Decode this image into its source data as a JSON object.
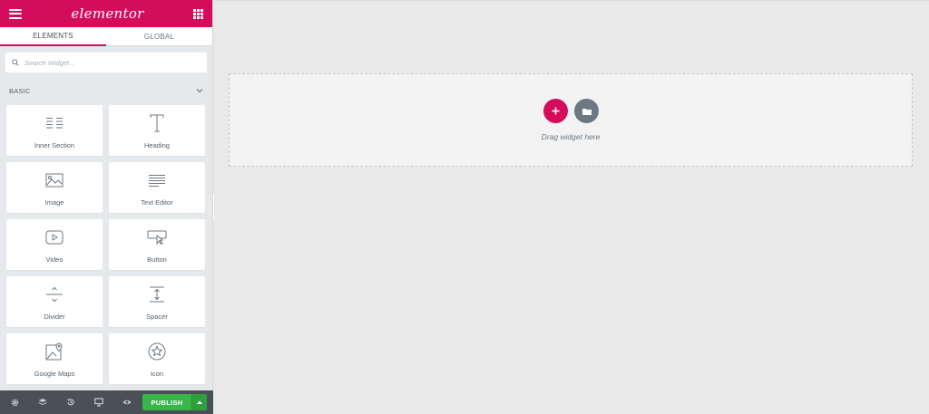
{
  "header": {
    "logo_text": "elementor",
    "menu_icon": "hamburger-icon",
    "apps_icon": "grid-icon"
  },
  "tabs": [
    {
      "label": "ELEMENTS",
      "active": true
    },
    {
      "label": "GLOBAL",
      "active": false
    }
  ],
  "search": {
    "placeholder": "Search Widget..."
  },
  "category": {
    "label": "BASIC"
  },
  "widgets": [
    {
      "label": "Inner Section",
      "icon": "inner-section-icon"
    },
    {
      "label": "Heading",
      "icon": "heading-icon"
    },
    {
      "label": "Image",
      "icon": "image-icon"
    },
    {
      "label": "Text Editor",
      "icon": "text-editor-icon"
    },
    {
      "label": "Video",
      "icon": "video-icon"
    },
    {
      "label": "Button",
      "icon": "button-icon"
    },
    {
      "label": "Divider",
      "icon": "divider-icon"
    },
    {
      "label": "Spacer",
      "icon": "spacer-icon"
    },
    {
      "label": "Google Maps",
      "icon": "google-maps-icon"
    },
    {
      "label": "Icon",
      "icon": "star-icon"
    }
  ],
  "footer": {
    "icons": [
      "settings-icon",
      "navigator-icon",
      "history-icon",
      "responsive-icon",
      "preview-icon"
    ],
    "publish_label": "PUBLISH"
  },
  "canvas": {
    "drop_text": "Drag widget here"
  },
  "colors": {
    "brand": "#d30c5c",
    "publish": "#39b54a",
    "footer": "#495157"
  }
}
